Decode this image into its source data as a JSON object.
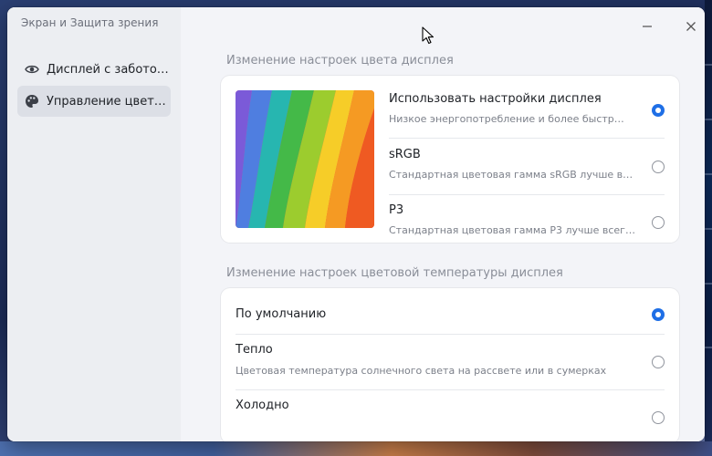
{
  "window": {
    "title": "Экран и Защита зрения"
  },
  "sidebar": {
    "items": [
      {
        "label": "Дисплей с заботой о...",
        "icon": "eye-icon",
        "active": false
      },
      {
        "label": "Управление цветом",
        "icon": "palette-icon",
        "active": true
      }
    ]
  },
  "color_settings": {
    "title": "Изменение настроек цвета дисплея",
    "options": [
      {
        "label": "Использовать настройки дисплея",
        "description": "Низкое энергопотребление и более быстрый...",
        "selected": true
      },
      {
        "label": "sRGB",
        "description": "Стандартная цветовая гамма sRGB лучше всего...",
        "selected": false
      },
      {
        "label": "P3",
        "description": "Стандартная цветовая гамма P3 лучше всего...",
        "selected": false
      }
    ]
  },
  "temperature_settings": {
    "title": "Изменение настроек цветовой температуры дисплея",
    "options": [
      {
        "label": "По умолчанию",
        "description": "",
        "selected": true
      },
      {
        "label": "Тепло",
        "description": "Цветовая температура солнечного света на рассвете или в сумерках",
        "selected": false
      },
      {
        "label": "Холодно",
        "description": "",
        "selected": false
      }
    ]
  },
  "colors": {
    "accent": "#1f6fe6",
    "sidebar_active": "#dcdfe6",
    "window_bg": "#eef0f4",
    "card_bg": "#ffffff"
  }
}
